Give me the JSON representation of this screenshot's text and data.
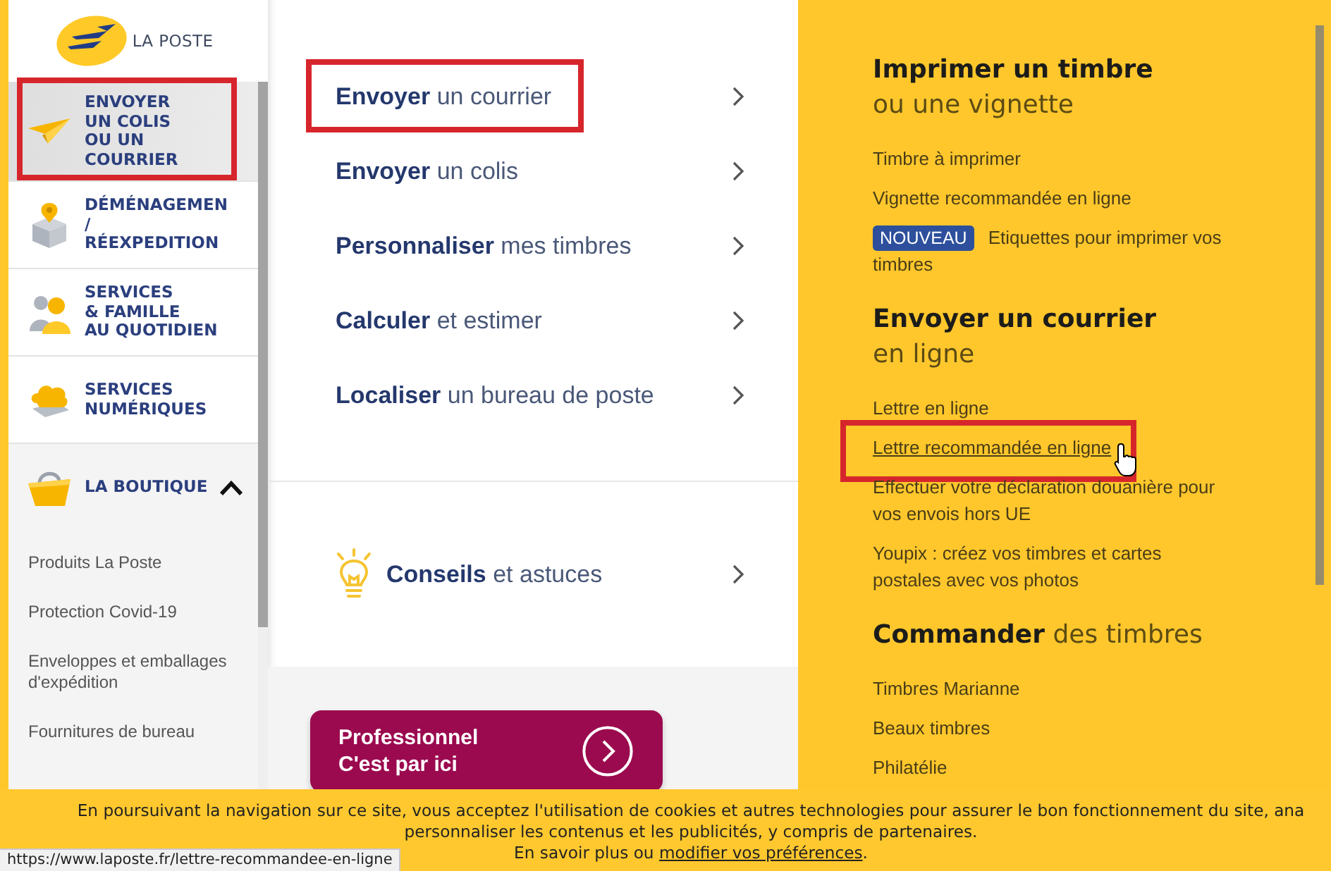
{
  "logo": {
    "text": "LA POSTE"
  },
  "sidebar": {
    "items": [
      {
        "kind": "link",
        "label": "ENVOYER\nUN COLIS\nOU UN\nCOURRIER",
        "selected": true,
        "highlighted": true
      },
      {
        "kind": "link",
        "label": "DÉMÉNAGEMEN\n/\nRÉEXPEDITION",
        "selected": false,
        "highlighted": false
      },
      {
        "kind": "link",
        "label": "SERVICES\n& FAMILLE\nAU QUOTIDIEN",
        "selected": false,
        "highlighted": false
      },
      {
        "kind": "link",
        "label": "SERVICES\nNUMÉRIQUES",
        "selected": false,
        "highlighted": false
      },
      {
        "kind": "group",
        "label": "LA BOUTIQUE",
        "selected": false,
        "highlighted": false,
        "expanded": true,
        "children": [
          {
            "label": "Produits La Poste"
          },
          {
            "label": "Protection Covid-19"
          },
          {
            "label": "Enveloppes et emballages\nd'expédition"
          },
          {
            "label": "Fournitures de bureau"
          }
        ]
      }
    ]
  },
  "main_menu": {
    "items": [
      {
        "text": "**Envoyer** un courrier",
        "highlighted": true
      },
      {
        "text": "**Envoyer** un colis",
        "highlighted": false
      },
      {
        "text": "**Personnaliser** mes timbres",
        "highlighted": false
      },
      {
        "text": "**Calculer** et estimer",
        "highlighted": false
      },
      {
        "text": "**Localiser** un bureau de poste",
        "highlighted": false
      }
    ],
    "tips": {
      "text": "**Conseils** et astuces"
    },
    "pro_button": {
      "label": "Professionnel\nC'est par ici"
    }
  },
  "right_panel": {
    "sections": [
      {
        "heading": "**Imprimer un timbre**\nou une vignette",
        "links": [
          {
            "kind": "link",
            "text": "Timbre à imprimer",
            "hovered": false,
            "highlighted": false
          },
          {
            "kind": "link",
            "text": "Vignette recommandée en ligne",
            "hovered": false,
            "highlighted": false
          },
          {
            "kind": "badge",
            "badge": "NOUVEAU",
            "text": "Etiquettes pour imprimer vos\ntimbres",
            "hovered": false,
            "highlighted": false
          }
        ]
      },
      {
        "heading": "**Envoyer un courrier**\nen ligne",
        "links": [
          {
            "kind": "link",
            "text": "Lettre en ligne",
            "hovered": false,
            "highlighted": false
          },
          {
            "kind": "link",
            "text": "Lettre recommandée en ligne",
            "hovered": true,
            "highlighted": true
          },
          {
            "kind": "link",
            "text": "Effectuer votre déclaration douanière pour\nvos envois hors UE",
            "hovered": false,
            "highlighted": false
          },
          {
            "kind": "link",
            "text": "Youpix : créez vos timbres et cartes\npostales avec vos photos",
            "hovered": false,
            "highlighted": false
          }
        ]
      },
      {
        "heading": "**Commander** des timbres",
        "links": [
          {
            "kind": "link",
            "text": "Timbres Marianne",
            "hovered": false,
            "highlighted": false
          },
          {
            "kind": "link",
            "text": "Beaux timbres",
            "hovered": false,
            "highlighted": false
          },
          {
            "kind": "link",
            "text": "Philatélie",
            "hovered": false,
            "highlighted": false
          }
        ]
      }
    ]
  },
  "cookie_banner": {
    "text": "En poursuivant la navigation sur ce site, vous acceptez l'utilisation de cookies et autres technologies pour assurer le bon fonctionnement du site, ana\npersonnaliser les contenus et les publicités, y compris de partenaires.",
    "more_text": "En savoir plus ou",
    "more_link": "modifier vos préférences",
    "more_end": "."
  },
  "status_bar": {
    "url": "https://www.laposte.fr/lettre-recommandee-en-ligne"
  }
}
